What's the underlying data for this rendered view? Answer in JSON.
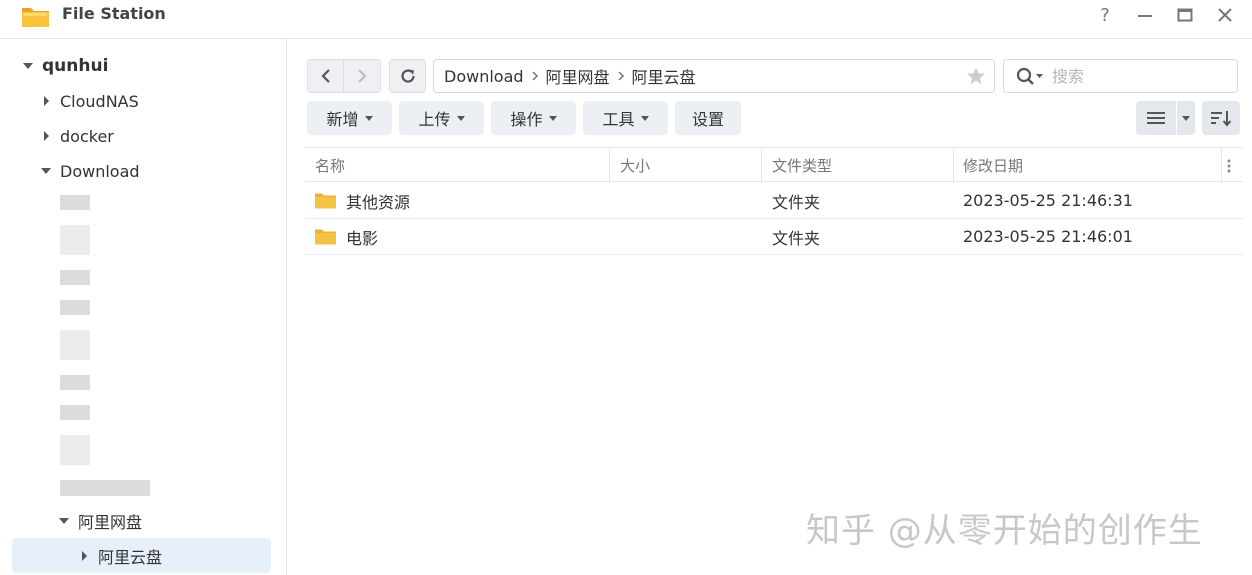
{
  "window": {
    "title": "File Station",
    "controls": [
      "?",
      "—",
      "□",
      "✕"
    ]
  },
  "sidebar": {
    "root": "qunhui",
    "items": [
      {
        "label": "CloudNAS",
        "expanded": false
      },
      {
        "label": "docker",
        "expanded": false
      },
      {
        "label": "Download",
        "expanded": true
      },
      {
        "label": "阿里网盘",
        "expanded": true
      },
      {
        "label": "阿里云盘",
        "expanded": false,
        "selected": true
      }
    ]
  },
  "toolbar": {
    "breadcrumb": [
      "Download",
      "阿里网盘",
      "阿里云盘"
    ],
    "search_placeholder": "搜索",
    "buttons": [
      {
        "label": "新增"
      },
      {
        "label": "上传"
      },
      {
        "label": "操作"
      },
      {
        "label": "工具"
      },
      {
        "label": "设置"
      }
    ]
  },
  "table": {
    "columns": [
      "名称",
      "大小",
      "文件类型",
      "修改日期"
    ],
    "rows": [
      {
        "name": "其他资源",
        "size": "",
        "type": "文件夹",
        "modified": "2023-05-25 21:46:31"
      },
      {
        "name": "电影",
        "size": "",
        "type": "文件夹",
        "modified": "2023-05-25 21:46:01"
      }
    ]
  },
  "watermark": "知乎 @从零开始的创作生",
  "colors": {
    "folder": "#f5c243",
    "selected_bg": "#e6effa",
    "button_bg": "#eceff3"
  }
}
